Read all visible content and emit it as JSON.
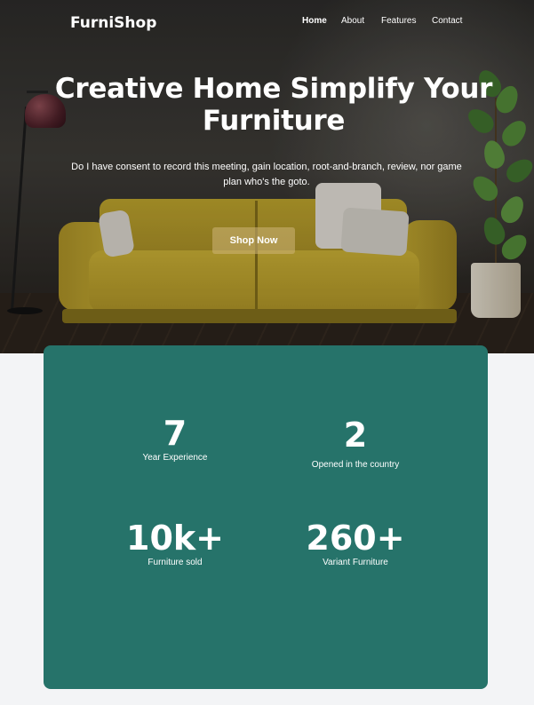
{
  "brand": {
    "name": "FurniShop"
  },
  "nav": {
    "items": [
      {
        "label": "Home",
        "active": true
      },
      {
        "label": "About",
        "active": false
      },
      {
        "label": "Features",
        "active": false
      },
      {
        "label": "Contact",
        "active": false
      }
    ]
  },
  "hero": {
    "title": "Creative Home Simplify Your Furniture",
    "subtitle": "Do I have consent to record this meeting, gain location, root-and-branch, review, nor game plan who's the goto.",
    "cta_label": "Shop Now"
  },
  "stats": [
    {
      "value": "7",
      "label": "Year Experience"
    },
    {
      "value": "2",
      "label": "Opened in the country"
    },
    {
      "value": "10k+",
      "label": "Furniture sold"
    },
    {
      "value": "260+",
      "label": "Variant Furniture"
    }
  ],
  "colors": {
    "stats_bg": "#26736a",
    "page_bg": "#f3f4f6",
    "cta_bg": "rgba(205,180,120,0.55)"
  }
}
